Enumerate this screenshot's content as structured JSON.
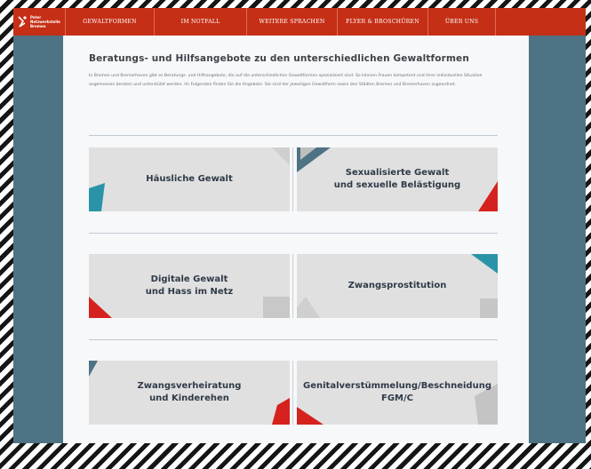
{
  "nav": {
    "logo_lines": [
      "Peter",
      "Netzwerkstelle",
      "Bremen"
    ],
    "items": [
      {
        "label": "Gewaltformen"
      },
      {
        "label": "Im Notfall"
      },
      {
        "label": "Weitere Sprachen"
      },
      {
        "label": "Flyer & Broschüren"
      },
      {
        "label": "Über uns"
      }
    ]
  },
  "page": {
    "title": "Beratungs- und Hilfsangebote zu den unterschiedlichen Gewaltformen",
    "intro": "In Bremen und Bremerhaven gibt es Beratungs- und Hilfsangebote, die auf die unterschiedlichen Gewaltformen spezialisiert sind. So können Frauen kompetent und ihrer individuellen Situation angemessen beraten und unterstützt werden. Im Folgenden finden Sie die Angebote. Sie sind der jeweiligen Gewaltform sowie den Städten Bremen und Bremerhaven zugeordnet."
  },
  "tiles": [
    {
      "label": "Häusliche Gewalt"
    },
    {
      "label": "Sexualisierte Gewalt\nund sexuelle Belästigung"
    },
    {
      "label": "Digitale Gewalt\nund Hass im Netz"
    },
    {
      "label": "Zwangsprostitution"
    },
    {
      "label": "Zwangsverheiratung\nund Kinderehen"
    },
    {
      "label": "Genitalverstümmelung/Beschneidung\nFGM/C"
    }
  ],
  "colors": {
    "nav_red": "#c52f16",
    "frame_teal": "#4e7384",
    "tile_gray": "#e0e0e0",
    "accent_red": "#d6221f",
    "accent_teal": "#2b93a8",
    "heading_dark": "#2f3a47"
  }
}
